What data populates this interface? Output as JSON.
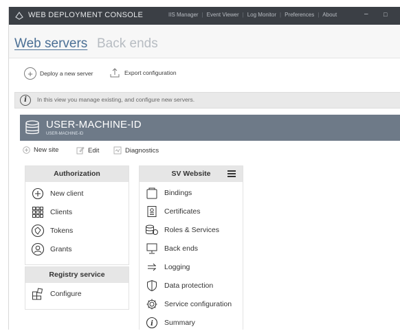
{
  "app": {
    "title": "WEB DEPLOYMENT CONSOLE"
  },
  "topnav": [
    "IIS Manager",
    "Event Viewer",
    "Log Monitor",
    "Preferences",
    "About"
  ],
  "window_controls": {
    "minimize": "–",
    "maximize": "□"
  },
  "tabs": [
    {
      "label": "Web servers",
      "active": true
    },
    {
      "label": "Back ends",
      "active": false
    }
  ],
  "actions": {
    "deploy": "Deploy a new server",
    "export": "Export configuration"
  },
  "info": {
    "text": "In this view you manage existing, and configure new servers."
  },
  "machine": {
    "name": "USER-MACHINE-ID",
    "subtitle": "USER-MACHINE-ID"
  },
  "machine_tools": {
    "new_site": "New site",
    "edit": "Edit",
    "diagnostics": "Diagnostics"
  },
  "authorization": {
    "title": "Authorization",
    "items": [
      {
        "label": "New client",
        "icon": "plus-circle-icon"
      },
      {
        "label": "Clients",
        "icon": "grid-icon"
      },
      {
        "label": "Tokens",
        "icon": "token-icon"
      },
      {
        "label": "Grants",
        "icon": "grant-icon"
      }
    ]
  },
  "registry": {
    "title": "Registry service",
    "items": [
      {
        "label": "Configure",
        "icon": "configure-icon"
      }
    ]
  },
  "website": {
    "title": "SV Website",
    "items": [
      {
        "label": "Bindings",
        "icon": "bindings-icon"
      },
      {
        "label": "Certificates",
        "icon": "certificate-icon"
      },
      {
        "label": "Roles & Services",
        "icon": "roles-icon"
      },
      {
        "label": "Back ends",
        "icon": "monitor-icon"
      },
      {
        "label": "Logging",
        "icon": "logging-icon"
      },
      {
        "label": "Data protection",
        "icon": "shield-icon"
      },
      {
        "label": "Service configuration",
        "icon": "gear-icon"
      },
      {
        "label": "Summary",
        "icon": "info-icon"
      }
    ]
  },
  "colors": {
    "titlebar": "#3b3f45",
    "machine_header": "#6e7a88",
    "link": "#4a6f95"
  }
}
